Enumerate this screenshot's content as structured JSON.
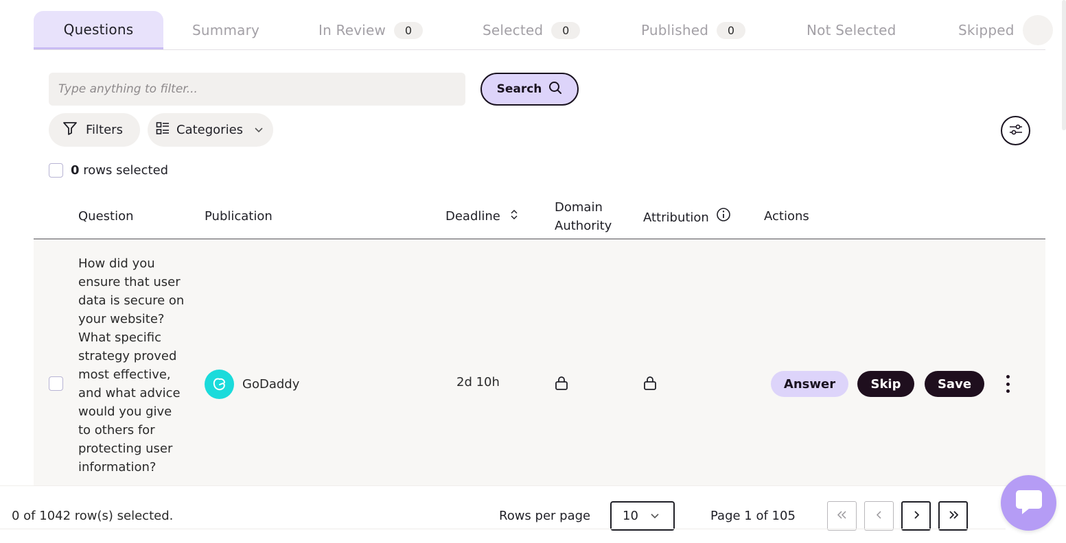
{
  "tabs": [
    {
      "label": "Questions",
      "count": null
    },
    {
      "label": "Summary",
      "count": null
    },
    {
      "label": "In Review",
      "count": "0"
    },
    {
      "label": "Selected",
      "count": "0"
    },
    {
      "label": "Published",
      "count": "0"
    },
    {
      "label": "Not Selected",
      "count": null
    },
    {
      "label": "Skipped",
      "count": null
    }
  ],
  "search": {
    "placeholder": "Type anything to filter...",
    "value": "",
    "button_label": "Search"
  },
  "filters": {
    "filters_label": "Filters",
    "categories_label": "Categories"
  },
  "selection": {
    "count": "0",
    "label": "rows selected"
  },
  "table": {
    "headers": {
      "question": "Question",
      "publication": "Publication",
      "deadline": "Deadline",
      "domain_authority": "Domain Authority",
      "attribution": "Attribution",
      "actions": "Actions"
    },
    "rows": [
      {
        "question": "How did you ensure that user data is secure on your website? What specific strategy proved most effective, and what advice would you give to others for protecting user information?",
        "publication": "GoDaddy",
        "deadline": "2d 10h",
        "domain_authority_icon": "lock-icon",
        "attribution_icon": "lock-icon",
        "actions": {
          "answer": "Answer",
          "skip": "Skip",
          "save": "Save"
        }
      }
    ]
  },
  "footer": {
    "selected_text": "0 of 1042 row(s) selected.",
    "rows_per_page_label": "Rows per page",
    "rows_per_page_value": "10",
    "page_label": "Page 1 of 105"
  },
  "colors": {
    "accent_light": "#ddd4fa",
    "dark_button": "#1f0f1e",
    "chat_button": "#b59cf5",
    "publication_logo": "#1bdbdb"
  }
}
